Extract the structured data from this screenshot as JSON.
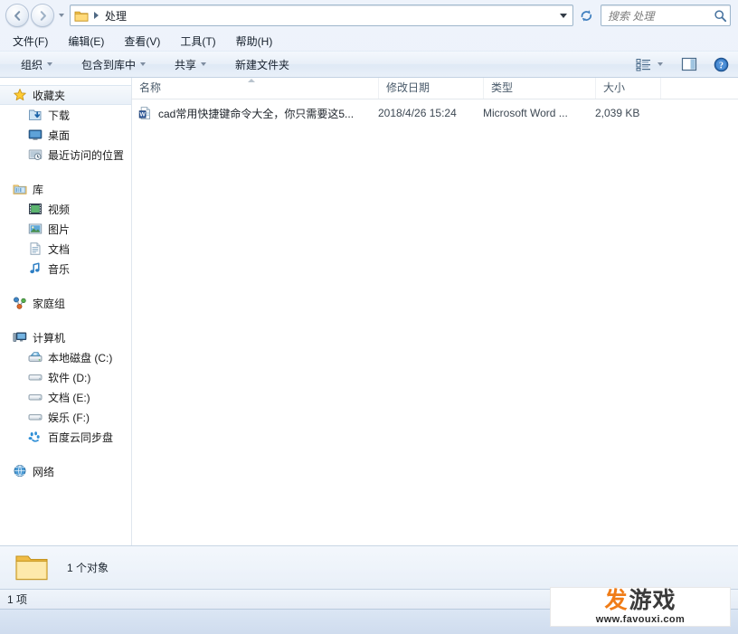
{
  "window": {
    "title": "处理"
  },
  "addressbar": {
    "back_tooltip": "后退",
    "forward_tooltip": "前进",
    "breadcrumb": "处理",
    "refresh_label": "刷新"
  },
  "search": {
    "placeholder": "搜索 处理",
    "value": ""
  },
  "menubar": {
    "items": [
      {
        "label": "文件(F)",
        "name": "menu-file"
      },
      {
        "label": "编辑(E)",
        "name": "menu-edit"
      },
      {
        "label": "查看(V)",
        "name": "menu-view"
      },
      {
        "label": "工具(T)",
        "name": "menu-tools"
      },
      {
        "label": "帮助(H)",
        "name": "menu-help"
      }
    ]
  },
  "toolbar": {
    "organize": "组织",
    "include_in_library": "包含到库中",
    "share": "共享",
    "new_folder": "新建文件夹",
    "view_options_label": "更改您的视图",
    "preview_pane_label": "显示预览窗格",
    "help_label": "帮助"
  },
  "sidebar": {
    "groups": [
      {
        "root": {
          "label": "收藏夹",
          "icon": "star-icon",
          "selected": true
        },
        "children": [
          {
            "label": "下载",
            "icon": "downloads-icon"
          },
          {
            "label": "桌面",
            "icon": "desktop-icon"
          },
          {
            "label": "最近访问的位置",
            "icon": "recent-places-icon"
          }
        ]
      },
      {
        "root": {
          "label": "库",
          "icon": "library-icon",
          "selected": false
        },
        "children": [
          {
            "label": "视频",
            "icon": "videos-icon"
          },
          {
            "label": "图片",
            "icon": "pictures-icon"
          },
          {
            "label": "文档",
            "icon": "documents-icon"
          },
          {
            "label": "音乐",
            "icon": "music-icon"
          }
        ]
      },
      {
        "root": {
          "label": "家庭组",
          "icon": "homegroup-icon",
          "selected": false
        },
        "children": []
      },
      {
        "root": {
          "label": "计算机",
          "icon": "computer-icon",
          "selected": false
        },
        "children": [
          {
            "label": "本地磁盘 (C:)",
            "icon": "system-drive-icon"
          },
          {
            "label": "软件 (D:)",
            "icon": "drive-icon"
          },
          {
            "label": "文档 (E:)",
            "icon": "drive-icon"
          },
          {
            "label": "娱乐 (F:)",
            "icon": "drive-icon"
          },
          {
            "label": "百度云同步盘",
            "icon": "baidu-sync-icon"
          }
        ]
      },
      {
        "root": {
          "label": "网络",
          "icon": "network-icon",
          "selected": false
        },
        "children": []
      }
    ]
  },
  "filelist": {
    "columns": [
      {
        "label": "名称",
        "name": "column-name"
      },
      {
        "label": "修改日期",
        "name": "column-date-modified"
      },
      {
        "label": "类型",
        "name": "column-type"
      },
      {
        "label": "大小",
        "name": "column-size"
      }
    ],
    "sort": {
      "column": "名称",
      "direction": "ascending"
    },
    "rows": [
      {
        "name": "cad常用快捷键命令大全，你只需要这5...",
        "date_modified": "2018/4/26 15:24",
        "type": "Microsoft Word ...",
        "size": "2,039 KB",
        "icon": "word-document-icon"
      }
    ]
  },
  "detailspane": {
    "icon": "folder-icon",
    "text": "1 个对象"
  },
  "statusbar": {
    "text": "1 项"
  },
  "watermark": {
    "text_orange": "发",
    "text_dark": "游戏",
    "url": "www.favouxi.com"
  },
  "colors": {
    "accent": "#f07c17",
    "chrome": "#e6eef9",
    "border": "#9eb6cc",
    "text": "#1a1a1a"
  }
}
